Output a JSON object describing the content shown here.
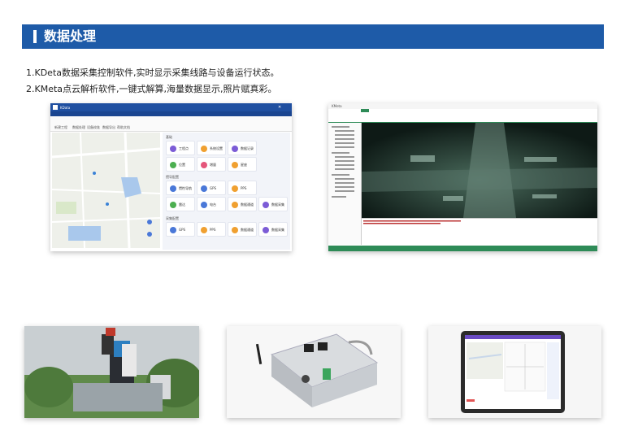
{
  "header": {
    "title": "数据处理"
  },
  "lines": [
    "1.KDeta数据采集控制软件,实时显示采集线路与设备运行状态。",
    "2.KMeta点云解析软件,一键式解算,海量数据显示,照片赋真彩。"
  ],
  "left_app": {
    "window_title": "KData",
    "toolbar": [
      "新建工程",
      "数据处理",
      "设备校准",
      "数据导出",
      "帮助文档"
    ],
    "sections": [
      {
        "title": "基础",
        "items": [
          "工程点",
          "系统设置",
          "数据记录",
          "位置",
          "增量",
          "星座"
        ]
      },
      {
        "title": "惯导配置",
        "items": [
          "惯性导航",
          "GPS",
          "PPS",
          "雷达",
          "电台",
          "数据通道",
          "数据采集"
        ]
      },
      {
        "title": "采集配置",
        "items": [
          "GPS",
          "PPS",
          "数据通道",
          "数据采集"
        ]
      }
    ]
  },
  "right_app": {
    "window_title": "KMeta"
  },
  "icon_colors": {
    "header": "#1e5ba8",
    "blue": "#4a78d8",
    "green": "#4caf50",
    "orange": "#f0a030",
    "purple": "#7c5cd6",
    "kmeta_green": "#2e8b57"
  }
}
